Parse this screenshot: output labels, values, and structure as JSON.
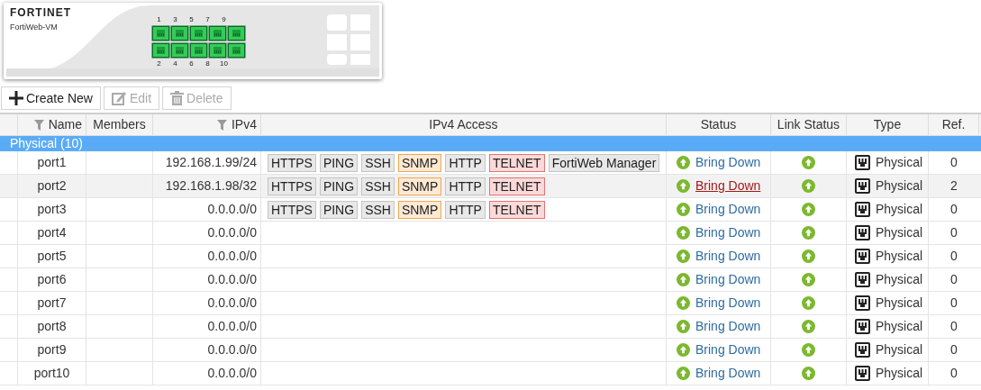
{
  "device": {
    "logo": "FORTINET",
    "model": "FortiWeb-VM",
    "ports": [
      {
        "label": "1",
        "up": true
      },
      {
        "label": "2",
        "up": true
      },
      {
        "label": "3",
        "up": true
      },
      {
        "label": "4",
        "up": true
      },
      {
        "label": "5",
        "up": true
      },
      {
        "label": "6",
        "up": true
      },
      {
        "label": "7",
        "up": true
      },
      {
        "label": "8",
        "up": true
      },
      {
        "label": "9",
        "up": true
      },
      {
        "label": "10",
        "up": true
      }
    ]
  },
  "toolbar": [
    {
      "label": "Create New",
      "kind": "create",
      "disabled": false
    },
    {
      "label": "Edit",
      "kind": "edit",
      "disabled": true
    },
    {
      "label": "Delete",
      "kind": "delete",
      "disabled": true
    }
  ],
  "table": {
    "columns": [
      {
        "label": "Name",
        "filter": true
      },
      {
        "label": "Members",
        "filter": false
      },
      {
        "label": "IPv4",
        "filter": true
      },
      {
        "label": "IPv4 Access",
        "filter": false
      },
      {
        "label": "Status",
        "filter": false
      },
      {
        "label": "Link Status",
        "filter": false
      },
      {
        "label": "Type",
        "filter": false
      },
      {
        "label": "Ref.",
        "filter": false
      }
    ],
    "group": "Physical (10)",
    "rows": [
      {
        "name": "port1",
        "ipv4": "192.168.1.99/24",
        "access": [
          {
            "label": "HTTPS",
            "kind": "plain"
          },
          {
            "label": "PING",
            "kind": "plain"
          },
          {
            "label": "SSH",
            "kind": "plain"
          },
          {
            "label": "SNMP",
            "kind": "warning"
          },
          {
            "label": "HTTP",
            "kind": "plain"
          },
          {
            "label": "TELNET",
            "kind": "danger"
          },
          {
            "label": "FortiWeb Manager",
            "kind": "plain"
          }
        ],
        "status": "Bring Down",
        "type": "Physical",
        "ref": "0",
        "hovered": false
      },
      {
        "name": "port2",
        "ipv4": "192.168.1.98/32",
        "access": [
          {
            "label": "HTTPS",
            "kind": "plain"
          },
          {
            "label": "PING",
            "kind": "plain"
          },
          {
            "label": "SSH",
            "kind": "plain"
          },
          {
            "label": "SNMP",
            "kind": "warning"
          },
          {
            "label": "HTTP",
            "kind": "plain"
          },
          {
            "label": "TELNET",
            "kind": "danger"
          }
        ],
        "status": "Bring Down",
        "type": "Physical",
        "ref": "2",
        "hovered": true
      },
      {
        "name": "port3",
        "ipv4": "0.0.0.0/0",
        "access": [
          {
            "label": "HTTPS",
            "kind": "plain"
          },
          {
            "label": "PING",
            "kind": "plain"
          },
          {
            "label": "SSH",
            "kind": "plain"
          },
          {
            "label": "SNMP",
            "kind": "warning"
          },
          {
            "label": "HTTP",
            "kind": "plain"
          },
          {
            "label": "TELNET",
            "kind": "danger"
          }
        ],
        "status": "Bring Down",
        "type": "Physical",
        "ref": "0",
        "hovered": false
      },
      {
        "name": "port4",
        "ipv4": "0.0.0.0/0",
        "access": [],
        "status": "Bring Down",
        "type": "Physical",
        "ref": "0",
        "hovered": false
      },
      {
        "name": "port5",
        "ipv4": "0.0.0.0/0",
        "access": [],
        "status": "Bring Down",
        "type": "Physical",
        "ref": "0",
        "hovered": false
      },
      {
        "name": "port6",
        "ipv4": "0.0.0.0/0",
        "access": [],
        "status": "Bring Down",
        "type": "Physical",
        "ref": "0",
        "hovered": false
      },
      {
        "name": "port7",
        "ipv4": "0.0.0.0/0",
        "access": [],
        "status": "Bring Down",
        "type": "Physical",
        "ref": "0",
        "hovered": false
      },
      {
        "name": "port8",
        "ipv4": "0.0.0.0/0",
        "access": [],
        "status": "Bring Down",
        "type": "Physical",
        "ref": "0",
        "hovered": false
      },
      {
        "name": "port9",
        "ipv4": "0.0.0.0/0",
        "access": [],
        "status": "Bring Down",
        "type": "Physical",
        "ref": "0",
        "hovered": false
      },
      {
        "name": "port10",
        "ipv4": "0.0.0.0/0",
        "access": [],
        "status": "Bring Down",
        "type": "Physical",
        "ref": "0",
        "hovered": false
      }
    ]
  }
}
